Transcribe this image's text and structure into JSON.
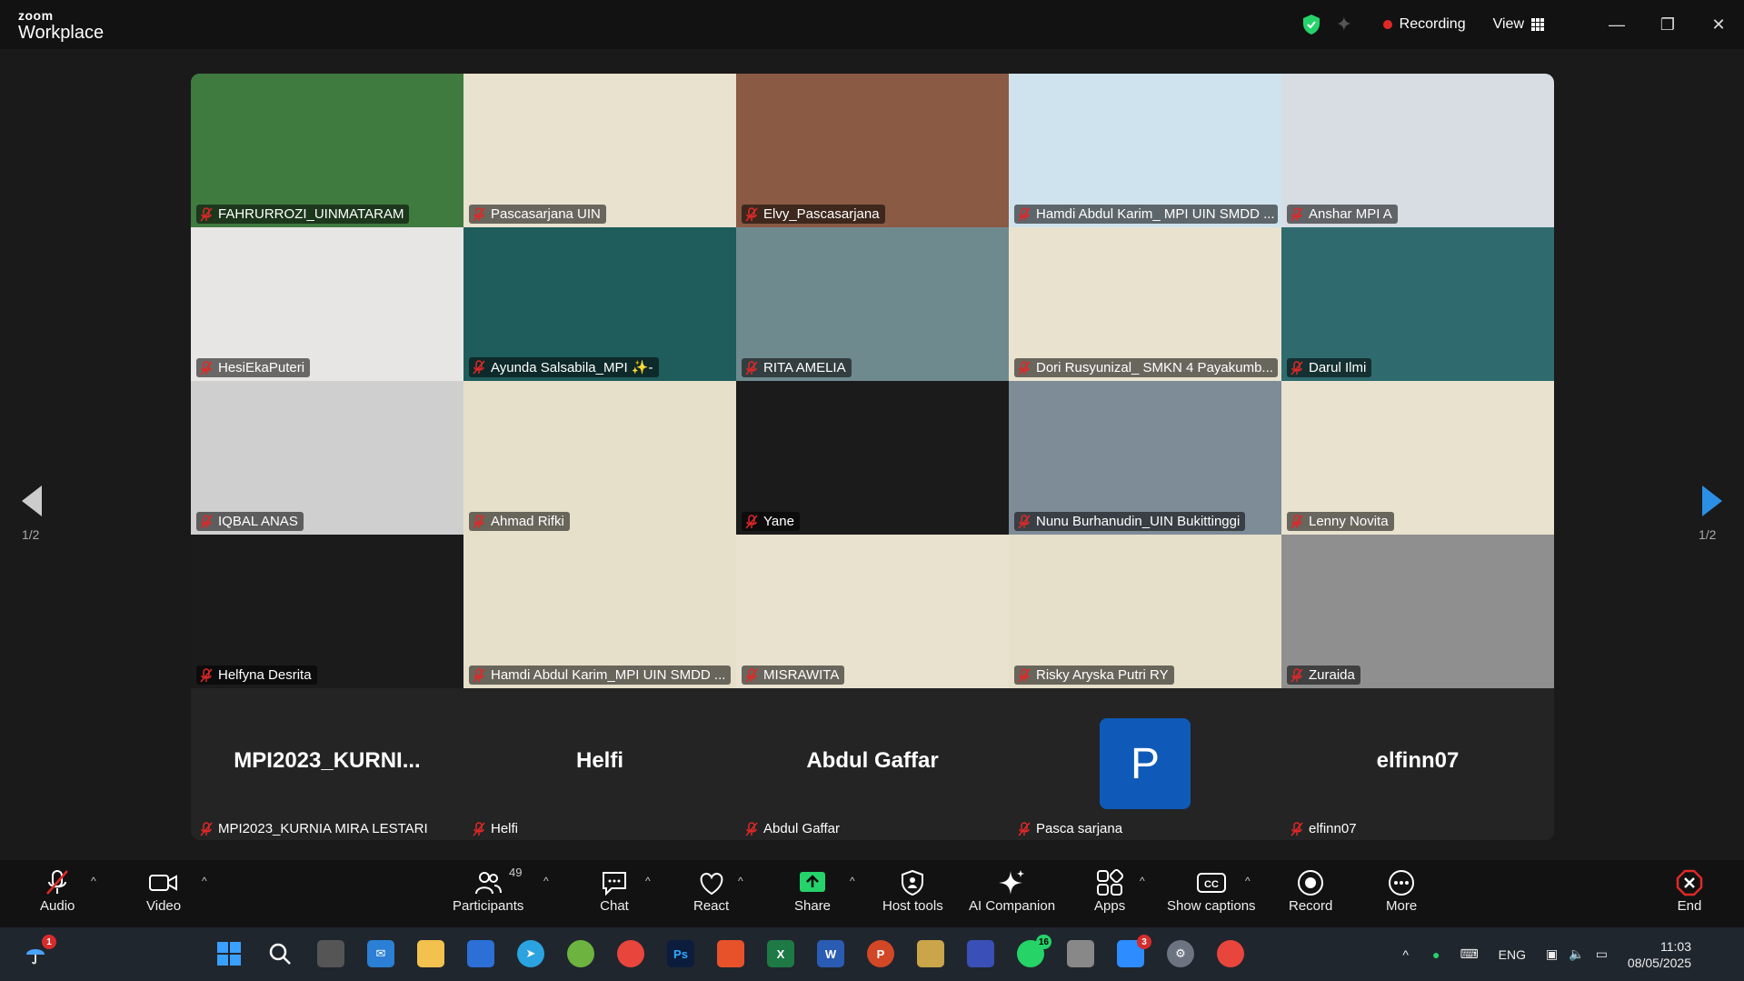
{
  "app": {
    "brand_small": "zoom",
    "brand_large": "Workplace"
  },
  "titlebar": {
    "recording_label": "Recording",
    "view_label": "View"
  },
  "colors": {
    "active_speaker": "#25d36b",
    "recording": "#e02828",
    "accent": "#2b8fe5",
    "end": "#e02828"
  },
  "pagination": {
    "left": "1/2",
    "right": "1/2"
  },
  "tiles": [
    {
      "name": "FAHRURROZI_UINMATARAM",
      "bg": "#3f7a3f",
      "active": true
    },
    {
      "name": "Pascasarjana UIN",
      "bg": "#e9e2cf"
    },
    {
      "name": "Elvy_Pascasarjana",
      "bg": "#8a5a44"
    },
    {
      "name": "Hamdi Abdul Karim_ MPI UIN SMDD ...",
      "bg": "#cfe3ee"
    },
    {
      "name": "Anshar MPI A",
      "bg": "#d7dde3"
    },
    {
      "name": "HesiEkaPuteri",
      "bg": "#e8e6e4"
    },
    {
      "name": "Ayunda Salsabila_MPI ✨-",
      "bg": "#1f5c5c"
    },
    {
      "name": "RITA AMELIA",
      "bg": "#6f8a8e"
    },
    {
      "name": "Dori Rusyunizal_ SMKN 4 Payakumb...",
      "bg": "#e9e2cf"
    },
    {
      "name": "Darul Ilmi",
      "bg": "#2f6b6e"
    },
    {
      "name": "IQBAL ANAS",
      "bg": "#cfcfcf"
    },
    {
      "name": "Ahmad Rifki",
      "bg": "#e6dfc9"
    },
    {
      "name": "Yane",
      "bg": "#1b1b1b"
    },
    {
      "name": "Nunu Burhanudin_UIN Bukittinggi",
      "bg": "#7e8c98"
    },
    {
      "name": "Lenny Novita",
      "bg": "#e9e2cf"
    },
    {
      "name": "Helfyna Desrita",
      "bg": "#1b1b1b"
    },
    {
      "name": "Hamdi Abdul Karim_MPI UIN SMDD ...",
      "bg": "#e6dfc9"
    },
    {
      "name": "MISRAWITA",
      "bg": "#e9e2cf"
    },
    {
      "name": "Risky Aryska Putri RY",
      "bg": "#e6dfc9"
    },
    {
      "name": "Zuraida",
      "bg": "#8f8f8f"
    }
  ],
  "name_tiles": [
    {
      "display": "MPI2023_KURNI...",
      "name": "MPI2023_KURNIA MIRA LESTARI"
    },
    {
      "display": "Helfi",
      "name": "Helfi"
    },
    {
      "display": "Abdul Gaffar",
      "name": "Abdul Gaffar"
    },
    {
      "display": "P",
      "name": "Pasca sarjana",
      "avatar": true
    },
    {
      "display": "elfinn07",
      "name": "elfinn07"
    }
  ],
  "toolbar": {
    "audio": "Audio",
    "video": "Video",
    "participants": "Participants",
    "participants_count": "49",
    "chat": "Chat",
    "react": "React",
    "share": "Share",
    "host_tools": "Host tools",
    "ai_companion": "AI Companion",
    "apps": "Apps",
    "captions": "Show captions",
    "record": "Record",
    "more": "More",
    "end": "End"
  },
  "taskbar": {
    "weather_badge": "1",
    "zoom_badge": "3",
    "whatsapp_badge": "16",
    "language": "ENG",
    "time": "11:03",
    "date": "08/05/2025"
  }
}
